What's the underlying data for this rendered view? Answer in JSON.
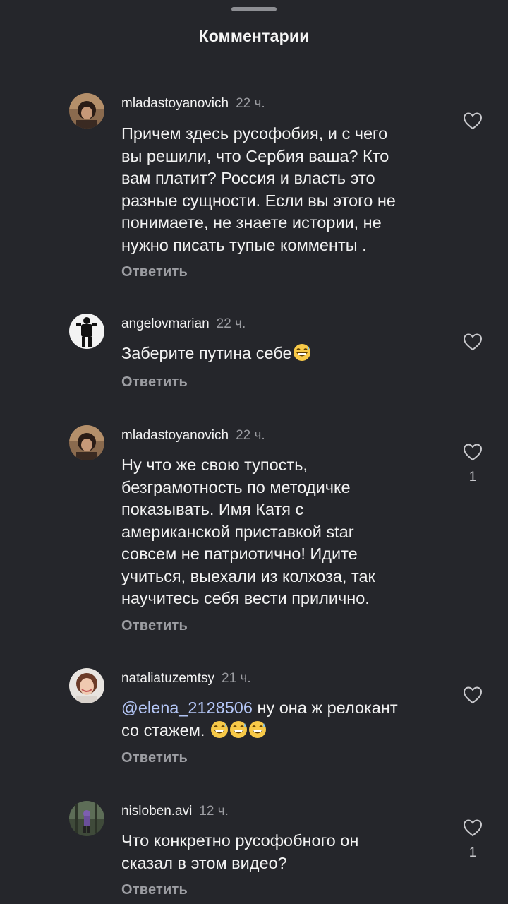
{
  "sheet": {
    "title": "Комментарии"
  },
  "comments": [
    {
      "username": "mladastoyanovich",
      "time": "22 ч.",
      "lines": [
        "Причем здесь русофобия, и с чего",
        "вы решили, что Сербия ваша? Кто",
        "вам платит? Россия и власть это",
        "разные сущности. Если вы этого не",
        "понимаете, не знаете истории, не",
        "нужно писать тупые комменты ."
      ],
      "reply_label": "Ответить",
      "like_count": ""
    },
    {
      "username": "angelovmarian",
      "time": "22 ч.",
      "lines": [
        "Заберите путина себе"
      ],
      "emoji": [
        "grinning-sweat-emoji"
      ],
      "reply_label": "Ответить",
      "like_count": ""
    },
    {
      "username": "mladastoyanovich",
      "time": "22 ч.",
      "lines": [
        "Ну что же свою тупость,",
        "безграмотность по методичке",
        "показывать. Имя Катя с",
        "американской приставкой star",
        "совсем не патриотично! Идите",
        "учиться, выехали из колхоза, так",
        "научитесь себя вести прилично."
      ],
      "reply_label": "Ответить",
      "like_count": "1"
    },
    {
      "username": "nataliatuzemtsy",
      "time": "21 ч.",
      "mention": "@elena_2128506",
      "lines": [
        " ну она ж релокант",
        "со стажем. "
      ],
      "emoji": [
        "grinning-sweat-emoji",
        "grinning-sweat-emoji",
        "grinning-sweat-emoji"
      ],
      "reply_label": "Ответить",
      "like_count": ""
    },
    {
      "username": "nisloben.avi",
      "time": "12 ч.",
      "lines": [
        "Что конкретно русофобного он",
        "сказал в этом видео?"
      ],
      "reply_label": "Ответить",
      "like_count": "1"
    }
  ],
  "icons": {
    "like": "heart-outline-icon"
  },
  "colors": {
    "background": "#25262b",
    "text": "#f2f2f2",
    "secondary_text": "#9c9da2",
    "mention": "#b4c6f6"
  }
}
